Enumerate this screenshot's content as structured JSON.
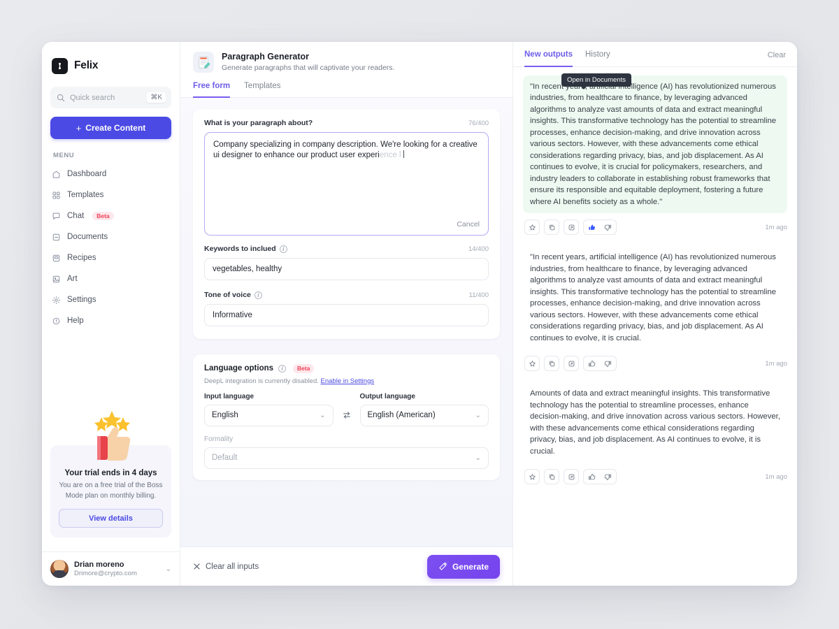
{
  "sidebar": {
    "brand": {
      "name": "Felix",
      "logo_icon": "felix-logo-icon"
    },
    "search": {
      "placeholder": "Quick search",
      "shortcut": "⌘K",
      "icon": "search-icon"
    },
    "create_button": {
      "label": "Create Content",
      "icon": "plus-icon"
    },
    "menu_label": "MENU",
    "items": [
      {
        "label": "Dashboard",
        "icon": "home-icon"
      },
      {
        "label": "Templates",
        "icon": "grid-icon"
      },
      {
        "label": "Chat",
        "icon": "chat-bubble-icon",
        "badge": "Beta"
      },
      {
        "label": "Documents",
        "icon": "document-icon"
      },
      {
        "label": "Recipes",
        "icon": "recipe-icon"
      },
      {
        "label": "Art",
        "icon": "image-icon"
      },
      {
        "label": "Settings",
        "icon": "gear-icon"
      },
      {
        "label": "Help",
        "icon": "help-circle-icon"
      }
    ],
    "trial": {
      "title": "Your trial ends in 4 days",
      "description": "You are on a free trial of the Boss Mode plan on monthly billing.",
      "button": "View details"
    },
    "user": {
      "name": "Drian moreno",
      "email": "Drimore@crypto.com",
      "chevron": "chevron-down-icon"
    }
  },
  "center": {
    "generator": {
      "title": "Paragraph Generator",
      "subtitle": "Generate paragraphs that will captivate your readers.",
      "icon": "notepad-pencil-icon"
    },
    "tabs": [
      {
        "label": "Free form",
        "active": true
      },
      {
        "label": "Templates",
        "active": false
      }
    ],
    "prompt": {
      "label": "What is your paragraph about?",
      "counter": "76/400",
      "value": "Company specializing in company description. We're looking for a creative ui designer to enhance our product user experi",
      "ghost_suffix": "ence l",
      "cancel_label": "Cancel"
    },
    "keywords": {
      "label": "Keywords to inclued",
      "counter": "14/400",
      "value": "vegetables, healthy",
      "info_icon": "info-icon"
    },
    "tone": {
      "label": "Tone of voice",
      "counter": "11/400",
      "value": "Informative",
      "info_icon": "info-icon"
    },
    "language_options": {
      "title": "Language options",
      "badge": "Beta",
      "info_icon": "info-icon",
      "note_text": "DeepL integration is currently disabled.",
      "note_link": "Enable in Settings",
      "input_language": {
        "label": "Input language",
        "value": "English"
      },
      "output_language": {
        "label": "Output language",
        "value": "English (American)"
      },
      "swap_icon": "swap-horizontal-icon",
      "formality": {
        "label": "Formality",
        "value": "Default"
      }
    },
    "footer": {
      "clear_label": "Clear all inputs",
      "clear_icon": "close-icon",
      "generate_label": "Generate",
      "generate_icon": "magic-wand-icon"
    }
  },
  "right": {
    "tabs": [
      {
        "label": "New outputs",
        "active": true
      },
      {
        "label": "History",
        "active": false
      }
    ],
    "clear_label": "Clear",
    "tooltip": "Open in Documents",
    "action_icons": [
      "star-icon",
      "copy-icon",
      "open-in-documents-icon",
      "thumbs-up-icon",
      "thumbs-down-icon"
    ],
    "outputs": [
      {
        "highlighted": true,
        "text": "\"In recent years, artificial intelligence (AI) has revolutionized numerous industries, from healthcare to finance, by leveraging advanced algorithms to analyze vast amounts of data and extract meaningful insights. This transformative technology has the potential to streamline processes, enhance decision-making, and drive innovation across various sectors. However, with these advancements come ethical considerations regarding privacy, bias, and job displacement. As AI continues to evolve, it is crucial for policymakers, researchers, and industry leaders to collaborate in establishing robust frameworks that ensure its responsible and equitable deployment, fostering a future where AI benefits society as a whole.\"",
        "time": "1m ago",
        "liked": true
      },
      {
        "highlighted": false,
        "text": "\"In recent years, artificial intelligence (AI) has revolutionized numerous industries, from healthcare to finance, by leveraging advanced algorithms to analyze vast amounts of data and extract meaningful insights. This transformative technology has the potential to streamline processes, enhance decision-making, and drive innovation across various sectors. However, with these advancements come ethical considerations regarding privacy, bias, and job displacement. As AI continues to evolve, it is crucial.",
        "time": "1m ago",
        "liked": false
      },
      {
        "highlighted": false,
        "text": "Amounts of data and extract meaningful insights. This transformative technology has the potential to streamline processes, enhance decision-making, and drive innovation across various sectors. However, with these advancements come ethical considerations regarding privacy, bias, and job displacement. As AI continues to evolve, it is crucial.",
        "time": "1m ago",
        "liked": false
      }
    ]
  },
  "colors": {
    "accent_purple": "#7644ee",
    "brand_blue": "#4b4ae4",
    "beta_red": "#ef4056",
    "highlight_green": "#eefaf1",
    "like_blue": "#3b5bfd"
  }
}
